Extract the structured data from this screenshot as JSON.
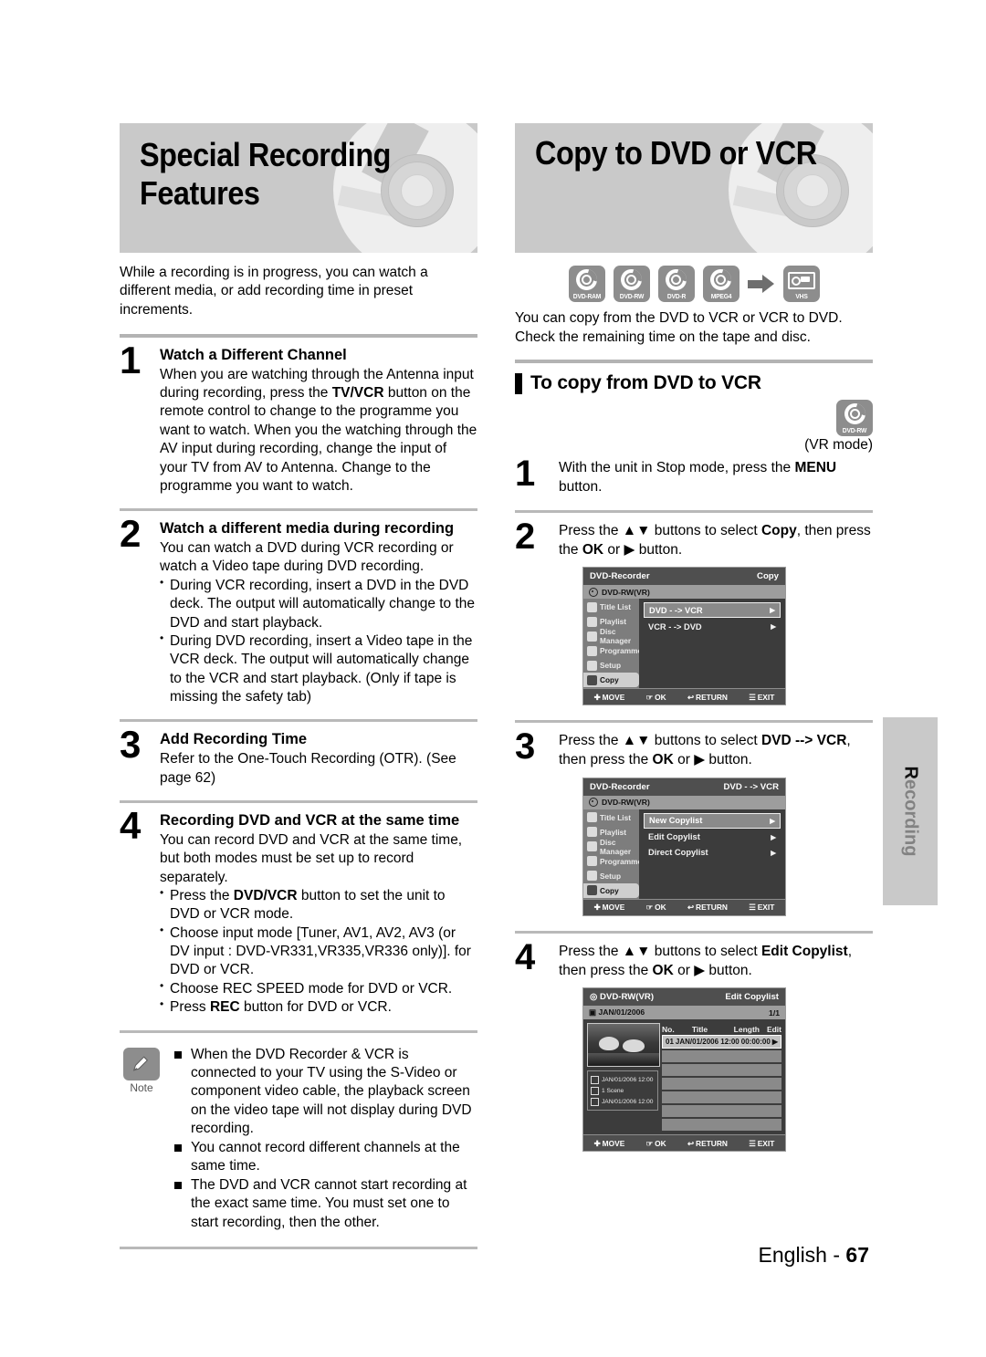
{
  "left": {
    "banner_title": "Special Recording\nFeatures",
    "intro": "While a recording is in progress, you can watch a different media, or add recording time in preset increments.",
    "steps": [
      {
        "num": "1",
        "title": "Watch a Different Channel",
        "body_a": "When you are watching through the Antenna input during recording, press the ",
        "bold_a": "TV/VCR",
        "body_b": " button on the remote control to change to the programme you want to watch. When you the watching through the AV input during recording, change the input of your TV from AV to Antenna. Change to the programme you want to watch."
      },
      {
        "num": "2",
        "title": "Watch a different media during recording",
        "body": "You can watch a DVD during VCR recording or watch a Video tape during DVD recording.",
        "bullets": [
          "During VCR recording, insert a DVD in the DVD deck. The output will automatically change to the DVD and start playback.",
          "During DVD recording, insert a Video tape in the VCR deck. The output will automatically change to the VCR and start playback. (Only if tape is missing the safety tab)"
        ]
      },
      {
        "num": "3",
        "title": "Add Recording Time",
        "body": "Refer to the One-Touch Recording (OTR). (See page 62)"
      },
      {
        "num": "4",
        "title": "Recording DVD and VCR at the same time",
        "body": "You can record DVD and VCR at the same time, but both modes must be set up to record separately.",
        "bullets": [
          "Press the DVD/VCR button to set the unit to DVD or VCR mode.",
          "Choose input mode [Tuner, AV1, AV2, AV3 (or DV input : DVD-VR331,VR335,VR336 only)]. for DVD or VCR.",
          "Choose REC SPEED mode for DVD or VCR.",
          "Press REC button for DVD or VCR."
        ]
      }
    ],
    "note": {
      "label": "Note",
      "items": [
        "When the DVD Recorder & VCR is connected to your TV using the S-Video or component video cable, the playback screen on the video tape will not display during DVD recording.",
        "You cannot record different channels at the same time.",
        "The DVD and VCR cannot start recording at the exact same time. You must set one to start recording, then the other."
      ]
    }
  },
  "right": {
    "banner_title": "Copy to DVD or VCR",
    "media_icons": [
      {
        "name": "dvd-ram-icon",
        "label": "DVD-RAM"
      },
      {
        "name": "dvd-rw-icon",
        "label": "DVD-RW"
      },
      {
        "name": "dvd-r-icon",
        "label": "DVD-R"
      },
      {
        "name": "mpeg4-icon",
        "label": "MPEG4"
      },
      {
        "name": "arrow-right-icon",
        "label": ""
      },
      {
        "name": "vhs-icon",
        "label": "VHS"
      }
    ],
    "lead": "You can copy from the DVD to VCR or VCR to DVD. Check the remaining time on the tape and disc.",
    "section_title": "To copy from DVD to VCR",
    "mode_icon_label": "DVD-RW",
    "mode_caption": "(VR mode)",
    "steps": [
      {
        "num": "1",
        "text_a": "With the unit in Stop mode, press the ",
        "bold_a": "MENU",
        "text_b": " button."
      },
      {
        "num": "2",
        "text_a": "Press the ▲▼ buttons to select ",
        "bold_a": "Copy",
        "text_b": ", then press the ",
        "bold_b": "OK",
        "text_c": " or ▶ button."
      },
      {
        "num": "3",
        "text_a": "Press the ▲▼ buttons to select ",
        "bold_a": "DVD --> VCR",
        "text_b": ", then press the ",
        "bold_b": "OK",
        "text_c": " or ▶ button."
      },
      {
        "num": "4",
        "text_a": "Press the ▲▼ buttons to select ",
        "bold_a": "Edit Copylist",
        "text_b": ", then press the ",
        "bold_b": "OK",
        "text_c": " or ▶ button."
      }
    ]
  },
  "osd_common": {
    "device": "DVD-Recorder",
    "disc": "DVD-RW(VR)",
    "sidebar": [
      "Title List",
      "Playlist",
      "Disc Manager",
      "Programme",
      "Setup",
      "Copy"
    ],
    "selected_sidebar": "Copy",
    "footer": [
      {
        "icon": "✚",
        "label": "MOVE"
      },
      {
        "icon": "☞",
        "label": "OK"
      },
      {
        "icon": "↩",
        "label": "RETURN"
      },
      {
        "icon": "☰",
        "label": "EXIT"
      }
    ]
  },
  "osd1": {
    "title": "Copy",
    "rows": [
      {
        "label": "DVD - -> VCR",
        "selected": true
      },
      {
        "label": "VCR - -> DVD",
        "selected": false
      }
    ]
  },
  "osd2": {
    "title": "DVD - -> VCR",
    "rows": [
      {
        "label": "New Copylist",
        "selected": true
      },
      {
        "label": "Edit Copylist",
        "selected": false
      },
      {
        "label": "Direct Copylist",
        "selected": false
      }
    ]
  },
  "osd3": {
    "disc": "DVD-RW(VR)",
    "title": "Edit Copylist",
    "date": "JAN/01/2006",
    "page": "1/1",
    "columns": [
      "No.",
      "Title",
      "Length",
      "Edit"
    ],
    "row": {
      "no": "01",
      "title": "JAN/01/2006 12:00",
      "length": "00:00:00",
      "edit": "▶"
    },
    "info": [
      "JAN/01/2006 12:00",
      "1 Scene",
      "JAN/01/2006 12:00"
    ]
  },
  "side_tab": {
    "bold": "R",
    "rest": "ecording"
  },
  "footer": {
    "lang": "English - ",
    "page": "67"
  }
}
